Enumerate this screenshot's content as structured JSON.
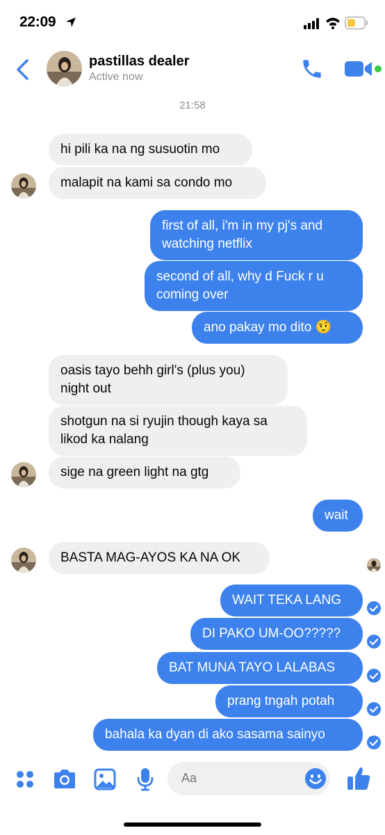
{
  "status_bar": {
    "time": "22:09",
    "icons": [
      "location-arrow-icon",
      "signal-icon",
      "wifi-icon",
      "battery-icon"
    ],
    "battery_color": "#f5c842"
  },
  "header": {
    "back_icon": "chevron-left-icon",
    "contact_name": "pastillas dealer",
    "status": "Active now",
    "actions": [
      "phone-icon",
      "video-camera-icon"
    ],
    "accent_color": "#3d82ec",
    "online_color": "#31cc46"
  },
  "conversation": {
    "timestamp": "21:58",
    "messages": [
      {
        "sender": "contact",
        "lines": [
          "hi pili ka na ng susuotin mo"
        ]
      },
      {
        "sender": "contact",
        "lines": [
          "malapit na kami sa condo mo"
        ]
      },
      {
        "sender": "me",
        "lines": [
          "first of all, i'm in my pj's and",
          "watching netflix"
        ]
      },
      {
        "sender": "me",
        "lines": [
          "second of all, why d Fuck r u",
          "coming over"
        ]
      },
      {
        "sender": "me",
        "lines": [
          "ano pakay mo dito 🤨"
        ]
      },
      {
        "sender": "contact",
        "lines": [
          "oasis tayo behh girl's (plus you)",
          "night out"
        ]
      },
      {
        "sender": "contact",
        "lines": [
          "shotgun na si ryujin though kaya sa",
          "likod ka nalang"
        ]
      },
      {
        "sender": "contact",
        "lines": [
          "sige na green light na gtg"
        ]
      },
      {
        "sender": "me",
        "lines": [
          "wait"
        ]
      },
      {
        "sender": "contact",
        "lines": [
          "BASTA MAG-AYOS KA NA OK"
        ]
      },
      {
        "sender": "me",
        "lines": [
          "WAIT TEKA LANG"
        ],
        "status": "delivered"
      },
      {
        "sender": "me",
        "lines": [
          "DI PAKO UM-OO?????"
        ],
        "status": "delivered"
      },
      {
        "sender": "me",
        "lines": [
          "BAT MUNA TAYO LALABAS"
        ],
        "status": "delivered"
      },
      {
        "sender": "me",
        "lines": [
          "prang tngah potah"
        ],
        "status": "delivered"
      },
      {
        "sender": "me",
        "lines": [
          "bahala ka dyan di ako sasama sainyo"
        ],
        "status": "delivered"
      }
    ],
    "incoming_bubble_color": "#efefef",
    "outgoing_bubble_color": "#3d82ec"
  },
  "composer": {
    "icons": [
      "apps-grid-icon",
      "camera-icon",
      "image-icon",
      "microphone-icon",
      "emoji-icon",
      "thumbs-up-icon"
    ],
    "placeholder": "Aa"
  }
}
